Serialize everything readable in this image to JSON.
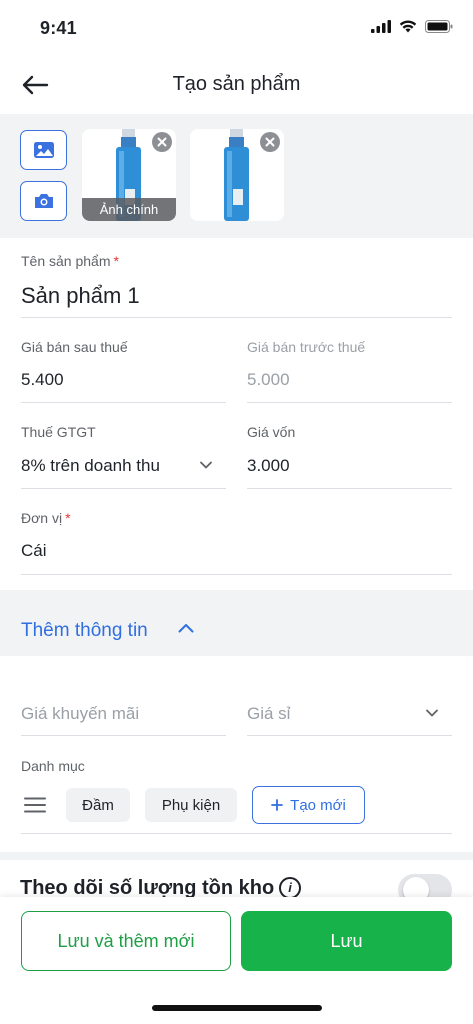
{
  "status": {
    "time": "9:41"
  },
  "header": {
    "title": "Tạo sản phẩm"
  },
  "photos": {
    "main_caption": "Ảnh chính"
  },
  "form": {
    "name_label": "Tên sản phẩm",
    "name_value": "Sản phẩm 1",
    "price_after_label": "Giá bán sau thuế",
    "price_after_value": "5.400",
    "price_before_label": "Giá bán trước thuế",
    "price_before_value": "5.000",
    "vat_label": "Thuế GTGT",
    "vat_value": "8% trên doanh thu",
    "cost_label": "Giá vốn",
    "cost_value": "3.000",
    "unit_label": "Đơn vị",
    "unit_value": "Cái",
    "required_mark": "*"
  },
  "more": {
    "label": "Thêm thông tin"
  },
  "extra": {
    "promo_placeholder": "Giá khuyến mãi",
    "wholesale_placeholder": "Giá sỉ",
    "category_label": "Danh mục",
    "chips": [
      "Đầm",
      "Phụ kiện"
    ],
    "new_chip": "Tạo mới"
  },
  "track": {
    "label": "Theo dõi số lượng tồn kho",
    "info": "i"
  },
  "footer": {
    "save_new": "Lưu và thêm mới",
    "save": "Lưu"
  },
  "colors": {
    "accent": "#2f6fe0",
    "green": "#17b24a",
    "danger": "#e53935"
  }
}
